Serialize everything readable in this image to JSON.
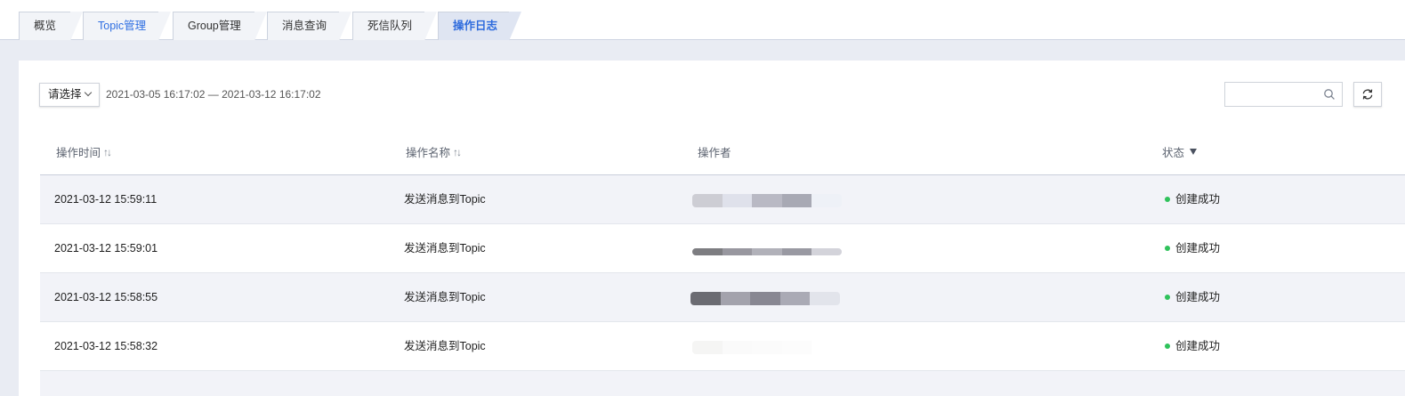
{
  "tabs": [
    {
      "label": "概览"
    },
    {
      "label": "Topic管理"
    },
    {
      "label": "Group管理"
    },
    {
      "label": "消息查询"
    },
    {
      "label": "死信队列"
    },
    {
      "label": "操作日志"
    }
  ],
  "toolbar": {
    "select_label": "请选择",
    "date_range": "2021-03-05 16:17:02 — 2021-03-12 16:17:02",
    "search_placeholder": ""
  },
  "table": {
    "columns": [
      {
        "label": "操作时间"
      },
      {
        "label": "操作名称"
      },
      {
        "label": "操作者"
      },
      {
        "label": "状态"
      }
    ],
    "rows": [
      {
        "time": "2021-03-12 15:59:11",
        "action": "发送消息到Topic",
        "status": "创建成功"
      },
      {
        "time": "2021-03-12 15:59:01",
        "action": "发送消息到Topic",
        "status": "创建成功"
      },
      {
        "time": "2021-03-12 15:58:55",
        "action": "发送消息到Topic",
        "status": "创建成功"
      },
      {
        "time": "2021-03-12 15:58:32",
        "action": "发送消息到Topic",
        "status": "创建成功"
      }
    ]
  },
  "colors": {
    "accent": "#2e6bdd",
    "status_success": "#2fc25b",
    "page_bg": "#e9ecf3"
  },
  "icons": [
    "search-icon",
    "refresh-icon",
    "sort-icon",
    "filter-icon",
    "chevron-down-icon"
  ]
}
